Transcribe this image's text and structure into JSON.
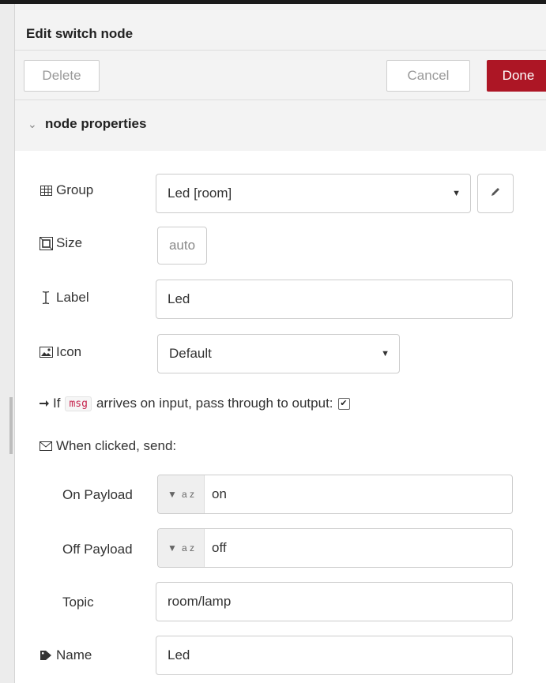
{
  "header": {
    "title": "Edit switch node"
  },
  "toolbar": {
    "delete_label": "Delete",
    "cancel_label": "Cancel",
    "done_label": "Done"
  },
  "section": {
    "title": "node properties"
  },
  "form": {
    "group": {
      "label": "Group",
      "value": "Led [room]"
    },
    "size": {
      "label": "Size",
      "value": "auto"
    },
    "label": {
      "label": "Label",
      "value": "Led"
    },
    "icon": {
      "label": "Icon",
      "value": "Default"
    },
    "passthrough": {
      "prefix": "If",
      "code": "msg",
      "suffix": "arrives on input, pass through to output:",
      "checked": true
    },
    "when_clicked": {
      "label": "When clicked, send:"
    },
    "on_payload": {
      "label": "On Payload",
      "type_glyph": "a z",
      "value": "on"
    },
    "off_payload": {
      "label": "Off Payload",
      "type_glyph": "a z",
      "value": "off"
    },
    "topic": {
      "label": "Topic",
      "value": "room/lamp"
    },
    "name": {
      "label": "Name",
      "value": "Led"
    }
  },
  "icons": {
    "group": "table-icon",
    "size": "size-frame-icon",
    "label": "text-cursor-icon",
    "icon": "image-icon",
    "arrow": "arrow-right-icon",
    "envelope": "envelope-icon",
    "tag": "tag-icon",
    "pencil": "pencil-icon"
  },
  "colors": {
    "done_button": "#ad1625",
    "msg_code": "#c7254e"
  }
}
